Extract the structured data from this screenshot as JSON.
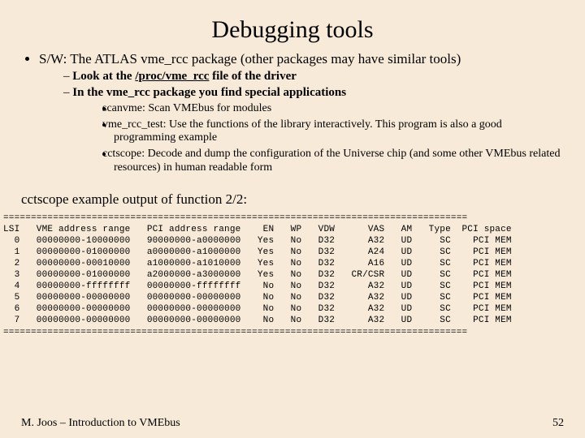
{
  "title": "Debugging tools",
  "bullet1": "S/W: The ATLAS vme_rcc package (other packages may have similar tools)",
  "sub1a_pre": "Look at the ",
  "sub1a_u": "/proc/vme_rcc",
  "sub1a_post": " file of the driver",
  "sub1b": "In the vme_rcc package you find special applications",
  "sub2a": "scanvme: Scan VMEbus for modules",
  "sub2b": "vme_rcc_test: Use the functions of the library interactively. This program is also a good programming example",
  "sub2c": "cctscope: Decode and dump the configuration of the Universe chip (and some other VMEbus related resources) in human readable form",
  "cctscope_caption": "cctscope example output of function 2/2:",
  "chart_data": {
    "type": "table",
    "columns": [
      "LSI",
      "VME address range",
      "PCI address range",
      "EN",
      "WP",
      "VDW",
      "VAS",
      "AM",
      "Type",
      "PCI space"
    ],
    "rows": [
      [
        "0",
        "00000000-10000000",
        "90000000-a0000000",
        "Yes",
        "No",
        "D32",
        "A32",
        "UD",
        "SC",
        "PCI MEM"
      ],
      [
        "1",
        "00000000-01000000",
        "a0000000-a1000000",
        "Yes",
        "No",
        "D32",
        "A24",
        "UD",
        "SC",
        "PCI MEM"
      ],
      [
        "2",
        "00000000-00010000",
        "a1000000-a1010000",
        "Yes",
        "No",
        "D32",
        "A16",
        "UD",
        "SC",
        "PCI MEM"
      ],
      [
        "3",
        "00000000-01000000",
        "a2000000-a3000000",
        "Yes",
        "No",
        "D32",
        "CR/CSR",
        "UD",
        "SC",
        "PCI MEM"
      ],
      [
        "4",
        "00000000-ffffffff",
        "00000000-ffffffff",
        "No",
        "No",
        "D32",
        "A32",
        "UD",
        "SC",
        "PCI MEM"
      ],
      [
        "5",
        "00000000-00000000",
        "00000000-00000000",
        "No",
        "No",
        "D32",
        "A32",
        "UD",
        "SC",
        "PCI MEM"
      ],
      [
        "6",
        "00000000-00000000",
        "00000000-00000000",
        "No",
        "No",
        "D32",
        "A32",
        "UD",
        "SC",
        "PCI MEM"
      ],
      [
        "7",
        "00000000-00000000",
        "00000000-00000000",
        "No",
        "No",
        "D32",
        "A32",
        "UD",
        "SC",
        "PCI MEM"
      ]
    ],
    "rule": "===================================================================================="
  },
  "footer": "M. Joos – Introduction to VMEbus",
  "pagenum": "52"
}
